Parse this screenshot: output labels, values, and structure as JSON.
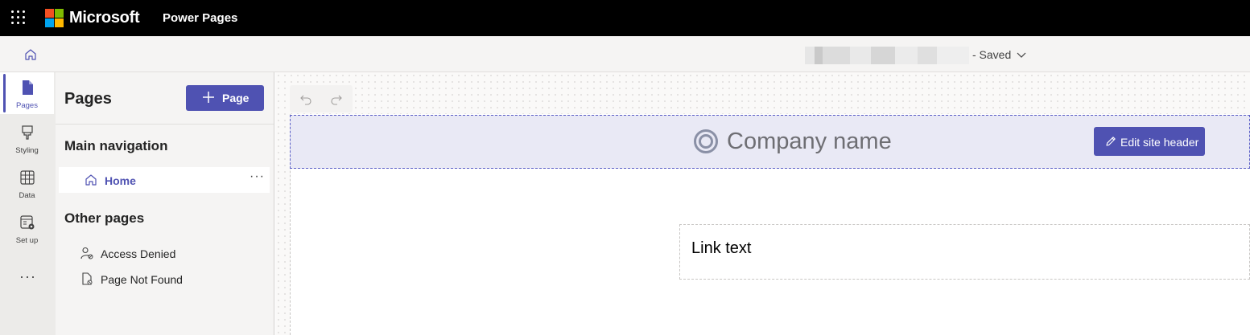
{
  "topbar": {
    "brand": "Microsoft",
    "app_name": "Power Pages",
    "logo_colors": [
      "#f25022",
      "#7fba00",
      "#00a4ef",
      "#ffb900"
    ]
  },
  "cmdbar": {
    "home_icon": "home-icon",
    "site_status": "- Saved",
    "status_icon": "chevron-down-icon"
  },
  "rail": {
    "items": [
      {
        "label": "Pages",
        "icon": "page-icon"
      },
      {
        "label": "Styling",
        "icon": "paintbrush-icon"
      },
      {
        "label": "Data",
        "icon": "table-icon"
      },
      {
        "label": "Set up",
        "icon": "settings-app-icon"
      }
    ],
    "more": "···"
  },
  "panel": {
    "title": "Pages",
    "add_button": "Page",
    "main_nav_title": "Main navigation",
    "main_nav_items": [
      {
        "label": "Home",
        "icon": "home-icon",
        "more": "···"
      }
    ],
    "other_title": "Other pages",
    "other_items": [
      {
        "label": "Access Denied",
        "icon": "person-lock-icon"
      },
      {
        "label": "Page Not Found",
        "icon": "page-error-icon"
      }
    ]
  },
  "canvas": {
    "company_name": "Company name",
    "edit_header_label": "Edit site header",
    "link_text": "Link text"
  },
  "colors": {
    "accent": "#4f52b2",
    "topbar": "#000000",
    "header_bg": "#e9e9f5"
  }
}
